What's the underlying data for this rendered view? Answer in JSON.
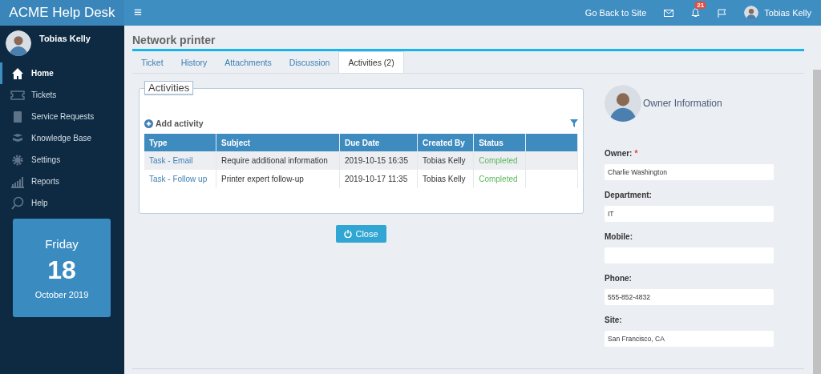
{
  "app": {
    "title": "ACME Help Desk"
  },
  "topbar": {
    "menu_glyph": "≡",
    "links": [
      {
        "label": "Go Back to Site"
      }
    ],
    "notification_count": "21",
    "user": "Tobias Kelly"
  },
  "sidebar": {
    "user": "Tobias Kelly",
    "items": [
      {
        "label": "Home",
        "selected": true
      },
      {
        "label": "Tickets",
        "selected": false
      },
      {
        "label": "Service Requests",
        "selected": false
      },
      {
        "label": "Knowledge Base",
        "selected": false
      },
      {
        "label": "Settings",
        "selected": false
      },
      {
        "label": "Reports",
        "selected": false
      },
      {
        "label": "Help",
        "selected": false
      }
    ],
    "calendar": {
      "weekday": "Friday",
      "day": "18",
      "month": "October 2019"
    }
  },
  "page": {
    "title": "Network printer",
    "tabs": [
      {
        "label": "Ticket",
        "selected": false
      },
      {
        "label": "History",
        "selected": false
      },
      {
        "label": "Attachments",
        "selected": false
      },
      {
        "label": "Discussion",
        "selected": false
      },
      {
        "label": "Activities (2)",
        "selected": true
      }
    ]
  },
  "activities": {
    "legend": "Activities",
    "add_label": "Add activity",
    "table": {
      "columns": [
        "Type",
        "Subject",
        "Due Date",
        "Created By",
        "Status"
      ],
      "rows": [
        {
          "type": "Task - Email",
          "subject": "Require additional information",
          "due": "2019-10-15 16:35",
          "created_by": "Tobias Kelly",
          "status": "Completed"
        },
        {
          "type": "Task - Follow up",
          "subject": "Printer expert follow-up",
          "due": "2019-10-17 11:35",
          "created_by": "Tobias Kelly",
          "status": "Completed"
        }
      ]
    }
  },
  "close_button": "Close",
  "owner": {
    "title": "Owner Information",
    "fields": [
      {
        "label": "Owner:",
        "required_mark": "*",
        "value": "Charlie Washington"
      },
      {
        "label": "Department:",
        "value": "IT"
      },
      {
        "label": "Mobile:"
      },
      {
        "label": "Phone:",
        "value": "555-852-4832"
      },
      {
        "label": "Site:",
        "value": "San Francisco, CA"
      }
    ]
  }
}
